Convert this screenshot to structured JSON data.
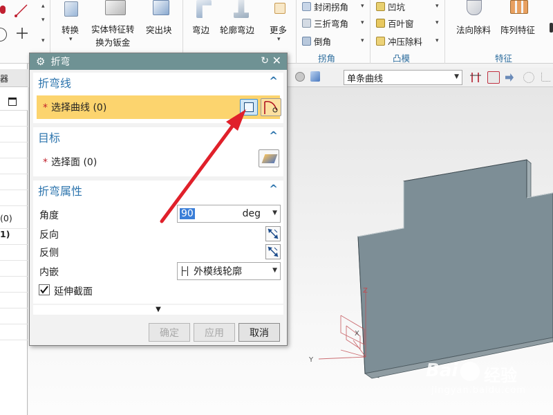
{
  "ribbon": {
    "buttons": {
      "convert": "转换",
      "solid_feature_line1": "实体特征转",
      "solid_feature_line2": "换为钣金",
      "emboss": "突出块",
      "flange": "弯边",
      "contour_flange": "轮廓弯边",
      "more": "更多",
      "normal_cutout": "法向除料",
      "pattern_feature": "阵列特征"
    },
    "small_items": {
      "closed_corner": "封闭拐角",
      "three_bend_corner": "三折弯角",
      "chamfer": "倒角",
      "dimple": "凹坑",
      "louver": "百叶窗",
      "drawn_cutout": "冲压除料"
    },
    "groups": {
      "corner": "拐角",
      "punch": "凸模",
      "feature": "特征"
    }
  },
  "toolbar2": {
    "curve_rule": "单条曲线"
  },
  "navigator": {
    "header": "器",
    "rows": [
      "(0)",
      "1)"
    ]
  },
  "dialog": {
    "title": "折弯",
    "bend_line": {
      "header": "折弯线",
      "select_label": "选择曲线 (0)"
    },
    "target": {
      "header": "目标",
      "select_label": "选择面 (0)"
    },
    "bend_properties": {
      "header": "折弯属性",
      "angle_label": "角度",
      "angle_value": "90",
      "angle_unit": "deg",
      "reverse_label": "反向",
      "reverse_side_label": "反侧",
      "inset_label": "内嵌",
      "inset_value": "外模线轮廓",
      "extend_label": "延伸截面",
      "extend_checked": true
    },
    "buttons": {
      "ok": "确定",
      "apply": "应用",
      "cancel": "取消"
    }
  },
  "viewport": {
    "axis_x": "X",
    "axis_y": "Y",
    "axis_z": "Z"
  },
  "watermark": {
    "brand": "Bai",
    "brand_suffix": "经验",
    "url": "jingyan.baidu.com"
  },
  "colors": {
    "dialog_title_bg": "#6f9294",
    "section_header": "#2c74ad",
    "selection_highlight": "#fcd46e",
    "part_face": "#7d8e96",
    "arrow": "#e0202a"
  }
}
